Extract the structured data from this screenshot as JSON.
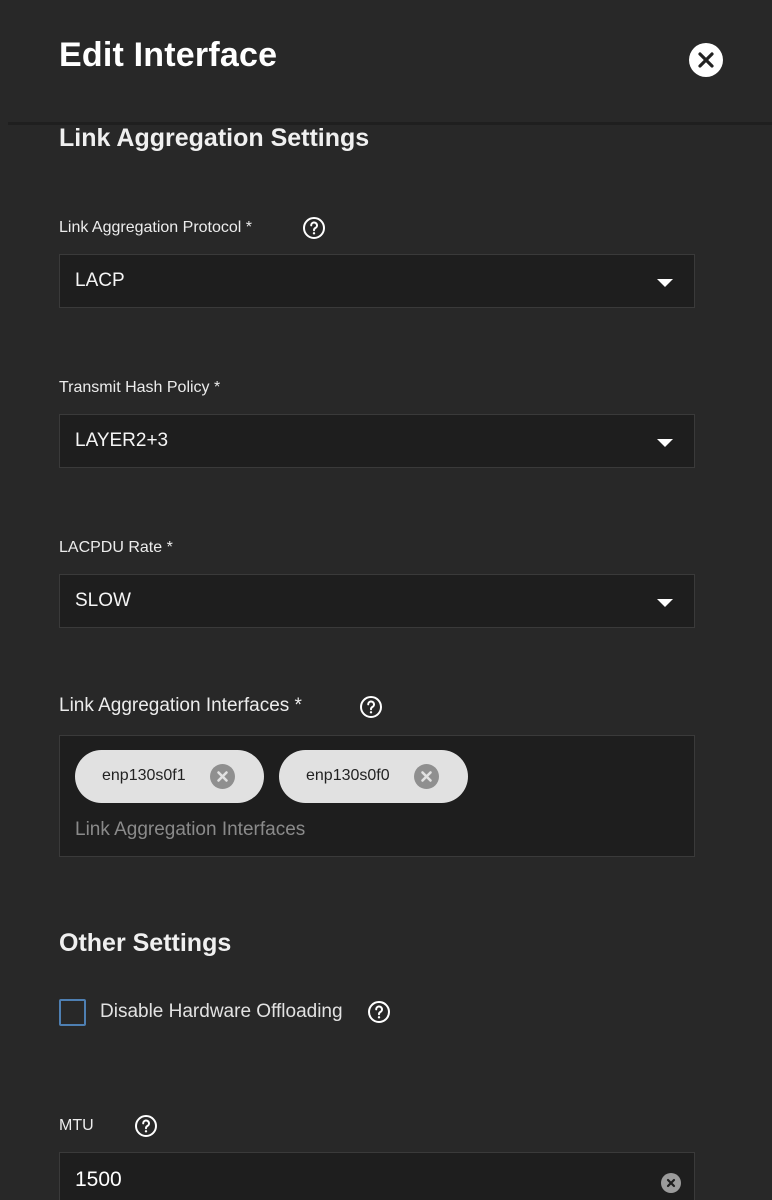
{
  "dialog": {
    "title": "Edit Interface",
    "close_icon": "close-icon"
  },
  "sections": {
    "link_aggregation": "Link Aggregation Settings",
    "other": "Other Settings"
  },
  "fields": {
    "lag_protocol": {
      "label": "Link Aggregation Protocol *",
      "value": "LACP",
      "help_icon": "help-icon"
    },
    "hash_policy": {
      "label": "Transmit Hash Policy *",
      "value": "LAYER2+3"
    },
    "lacpdu_rate": {
      "label": "LACPDU Rate *",
      "value": "SLOW"
    },
    "lag_interfaces": {
      "label": "Link Aggregation Interfaces *",
      "placeholder": "Link Aggregation Interfaces",
      "chips": [
        "enp130s0f1",
        "enp130s0f0"
      ],
      "help_icon": "help-icon"
    },
    "disable_offloading": {
      "label": "Disable Hardware Offloading",
      "checked": false,
      "help_icon": "help-icon"
    },
    "mtu": {
      "label": "MTU",
      "value": "1500",
      "help_icon": "help-icon"
    }
  },
  "colors": {
    "background": "#282828",
    "input_background": "#1e1e1e",
    "chip_background": "#e1e1e1",
    "checkbox_border": "#4e7fb2"
  }
}
